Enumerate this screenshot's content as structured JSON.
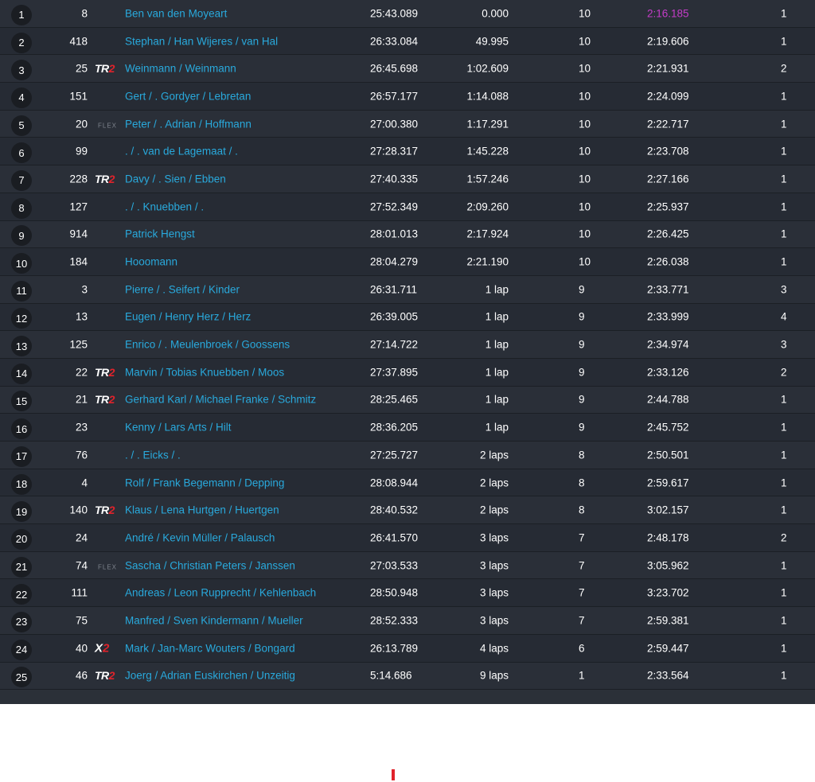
{
  "results": [
    {
      "pos": "1",
      "num": "8",
      "cls": "",
      "driver": "Ben van den Moyeart",
      "time": "25:43.089",
      "gap": "0.000",
      "laps": "10",
      "best": "2:16.185",
      "fastest": true,
      "pit": "1"
    },
    {
      "pos": "2",
      "num": "418",
      "cls": "",
      "driver": "Stephan / Han Wijeres / van Hal",
      "time": "26:33.084",
      "gap": "49.995",
      "laps": "10",
      "best": "2:19.606",
      "pit": "1"
    },
    {
      "pos": "3",
      "num": "25",
      "cls": "TR2",
      "driver": "Weinmann / Weinmann",
      "time": "26:45.698",
      "gap": "1:02.609",
      "laps": "10",
      "best": "2:21.931",
      "pit": "2"
    },
    {
      "pos": "4",
      "num": "151",
      "cls": "",
      "driver": "Gert / . Gordyer / Lebretan",
      "time": "26:57.177",
      "gap": "1:14.088",
      "laps": "10",
      "best": "2:24.099",
      "pit": "1"
    },
    {
      "pos": "5",
      "num": "20",
      "cls": "FLEX",
      "driver": "Peter / . Adrian / Hoffmann",
      "time": "27:00.380",
      "gap": "1:17.291",
      "laps": "10",
      "best": "2:22.717",
      "pit": "1"
    },
    {
      "pos": "6",
      "num": "99",
      "cls": "",
      "driver": ". / . van de Lagemaat / .",
      "time": "27:28.317",
      "gap": "1:45.228",
      "laps": "10",
      "best": "2:23.708",
      "pit": "1"
    },
    {
      "pos": "7",
      "num": "228",
      "cls": "TR2",
      "driver": "Davy / . Sien / Ebben",
      "time": "27:40.335",
      "gap": "1:57.246",
      "laps": "10",
      "best": "2:27.166",
      "pit": "1"
    },
    {
      "pos": "8",
      "num": "127",
      "cls": "",
      "driver": ". / . Knuebben / .",
      "time": "27:52.349",
      "gap": "2:09.260",
      "laps": "10",
      "best": "2:25.937",
      "pit": "1"
    },
    {
      "pos": "9",
      "num": "914",
      "cls": "",
      "driver": "Patrick Hengst",
      "time": "28:01.013",
      "gap": "2:17.924",
      "laps": "10",
      "best": "2:26.425",
      "pit": "1"
    },
    {
      "pos": "10",
      "num": "184",
      "cls": "",
      "driver": "Hooomann",
      "time": "28:04.279",
      "gap": "2:21.190",
      "laps": "10",
      "best": "2:26.038",
      "pit": "1"
    },
    {
      "pos": "11",
      "num": "3",
      "cls": "",
      "driver": "Pierre / . Seifert / Kinder",
      "time": "26:31.711",
      "gap": "1 lap",
      "laps": "9",
      "best": "2:33.771",
      "pit": "3"
    },
    {
      "pos": "12",
      "num": "13",
      "cls": "",
      "driver": "Eugen / Henry Herz / Herz",
      "time": "26:39.005",
      "gap": "1 lap",
      "laps": "9",
      "best": "2:33.999",
      "pit": "4"
    },
    {
      "pos": "13",
      "num": "125",
      "cls": "",
      "driver": "Enrico / . Meulenbroek / Goossens",
      "time": "27:14.722",
      "gap": "1 lap",
      "laps": "9",
      "best": "2:34.974",
      "pit": "3"
    },
    {
      "pos": "14",
      "num": "22",
      "cls": "TR2",
      "driver": "Marvin / Tobias Knuebben / Moos",
      "time": "27:37.895",
      "gap": "1 lap",
      "laps": "9",
      "best": "2:33.126",
      "pit": "2"
    },
    {
      "pos": "15",
      "num": "21",
      "cls": "TR2",
      "driver": "Gerhard Karl / Michael Franke / Schmitz",
      "time": "28:25.465",
      "gap": "1 lap",
      "laps": "9",
      "best": "2:44.788",
      "pit": "1"
    },
    {
      "pos": "16",
      "num": "23",
      "cls": "",
      "driver": "Kenny / Lars Arts / Hilt",
      "time": "28:36.205",
      "gap": "1 lap",
      "laps": "9",
      "best": "2:45.752",
      "pit": "1"
    },
    {
      "pos": "17",
      "num": "76",
      "cls": "",
      "driver": ". / . Eicks / .",
      "time": "27:25.727",
      "gap": "2 laps",
      "laps": "8",
      "best": "2:50.501",
      "pit": "1"
    },
    {
      "pos": "18",
      "num": "4",
      "cls": "",
      "driver": "Rolf / Frank Begemann / Depping",
      "time": "28:08.944",
      "gap": "2 laps",
      "laps": "8",
      "best": "2:59.617",
      "pit": "1"
    },
    {
      "pos": "19",
      "num": "140",
      "cls": "TR2",
      "driver": "Klaus / Lena Hurtgen / Huertgen",
      "time": "28:40.532",
      "gap": "2 laps",
      "laps": "8",
      "best": "3:02.157",
      "pit": "1"
    },
    {
      "pos": "20",
      "num": "24",
      "cls": "",
      "driver": "André / Kevin Müller / Palausch",
      "time": "26:41.570",
      "gap": "3 laps",
      "laps": "7",
      "best": "2:48.178",
      "pit": "2"
    },
    {
      "pos": "21",
      "num": "74",
      "cls": "FLEX",
      "driver": "Sascha / Christian Peters / Janssen",
      "time": "27:03.533",
      "gap": "3 laps",
      "laps": "7",
      "best": "3:05.962",
      "pit": "1"
    },
    {
      "pos": "22",
      "num": "111",
      "cls": "",
      "driver": "Andreas / Leon Rupprecht / Kehlenbach",
      "time": "28:50.948",
      "gap": "3 laps",
      "laps": "7",
      "best": "3:23.702",
      "pit": "1"
    },
    {
      "pos": "23",
      "num": "75",
      "cls": "",
      "driver": "Manfred / Sven Kindermann / Mueller",
      "time": "28:52.333",
      "gap": "3 laps",
      "laps": "7",
      "best": "2:59.381",
      "pit": "1"
    },
    {
      "pos": "24",
      "num": "40",
      "cls": "X2",
      "driver": "Mark / Jan-Marc Wouters / Bongard",
      "time": "26:13.789",
      "gap": "4 laps",
      "laps": "6",
      "best": "2:59.447",
      "pit": "1"
    },
    {
      "pos": "25",
      "num": "46",
      "cls": "TR2",
      "driver": "Joerg / Adrian Euskirchen / Unzeitig",
      "time": "5:14.686",
      "gap": "9 laps",
      "laps": "1",
      "best": "2:33.564",
      "pit": "1"
    }
  ],
  "colors": {
    "driver_link": "#29a9dc",
    "fastest_lap": "#c43cc8",
    "class_accent": "#e0232b",
    "row_bg": "#2a2f38"
  },
  "icons": {
    "TR2": "tr2-class-badge-icon",
    "X2": "x2-class-badge-icon",
    "FLEX": "flex-class-badge-icon"
  }
}
